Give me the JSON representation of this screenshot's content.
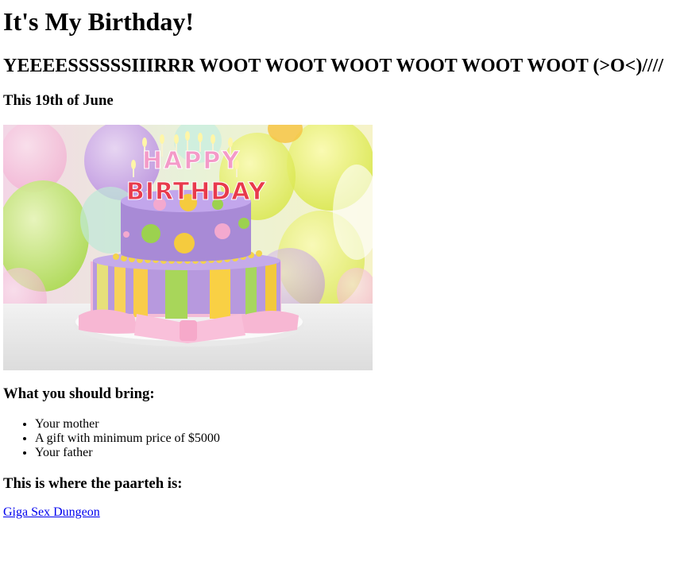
{
  "heading": "It's My Birthday!",
  "subheading": "YEEEESSSSSSIIIRRR WOOT WOOT WOOT WOOT WOOT WOOT (>O<)////",
  "date_line": "This 19th of June",
  "cake_image": {
    "topper_text_1": "HAPPY",
    "topper_text_2": "BIRTHDAY"
  },
  "bring_heading": "What you should bring:",
  "bring_items": [
    "Your mother",
    "A gift with minimum price of $5000",
    "Your father"
  ],
  "location_heading": "This is where the paarteh is:",
  "location_link": "Giga Sex Dungeon"
}
